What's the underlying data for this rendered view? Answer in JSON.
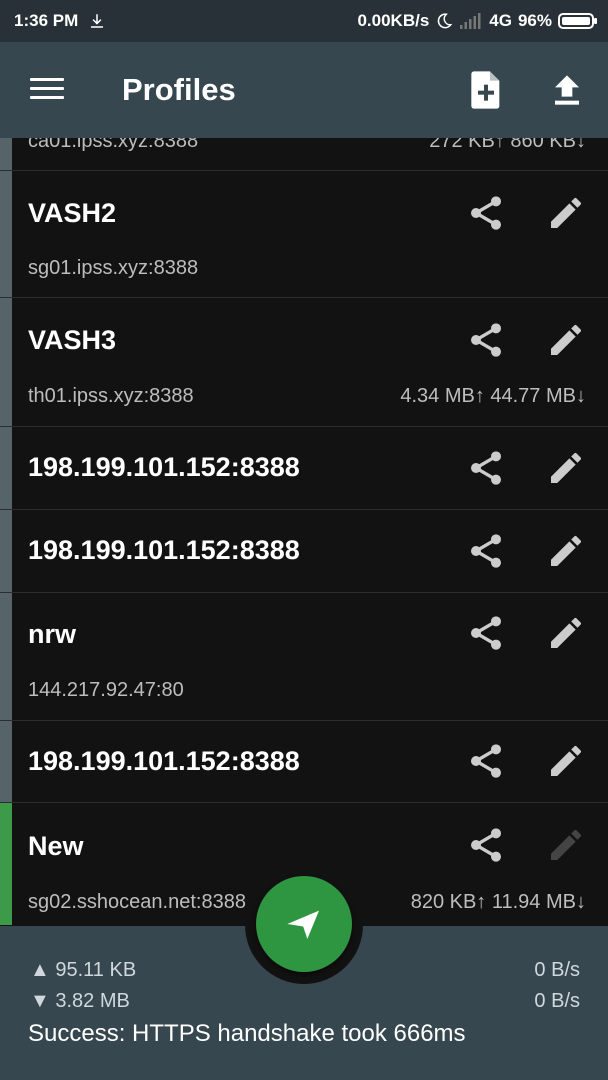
{
  "status_bar": {
    "time": "1:36 PM",
    "net_speed": "0.00KB/s",
    "network": "4G",
    "battery": "96%"
  },
  "app_bar": {
    "title": "Profiles"
  },
  "profiles": [
    {
      "name": "",
      "host": "ca01.ipss.xyz:8388",
      "traffic": "272 KB↑  860 KB↓"
    },
    {
      "name": "VASH2",
      "host": "sg01.ipss.xyz:8388",
      "traffic": ""
    },
    {
      "name": "VASH3",
      "host": "th01.ipss.xyz:8388",
      "traffic": "4.34 MB↑ 44.77 MB↓"
    },
    {
      "name": "198.199.101.152:8388",
      "host": "",
      "traffic": ""
    },
    {
      "name": "198.199.101.152:8388",
      "host": "",
      "traffic": ""
    },
    {
      "name": "nrw",
      "host": "144.217.92.47:80",
      "traffic": ""
    },
    {
      "name": "198.199.101.152:8388",
      "host": "",
      "traffic": ""
    },
    {
      "name": "New",
      "host": "sg02.sshocean.net:8388",
      "traffic": "820 KB↑  11.94 MB↓"
    }
  ],
  "bottom": {
    "tx_total": "▲ 95.11 KB",
    "rx_total": "▼ 3.82 MB",
    "tx_rate": "0 B/s",
    "rx_rate": "0 B/s",
    "message": "Success: HTTPS handshake took 666ms"
  },
  "colors": {
    "app_bar": "#37474F",
    "accent": "#2E9540",
    "background": "#121212"
  },
  "icons": [
    "download-icon",
    "moon-icon",
    "signal-icon",
    "battery-icon",
    "menu-icon",
    "add-file-icon",
    "upload-icon",
    "share-icon",
    "edit-icon",
    "send-icon"
  ]
}
